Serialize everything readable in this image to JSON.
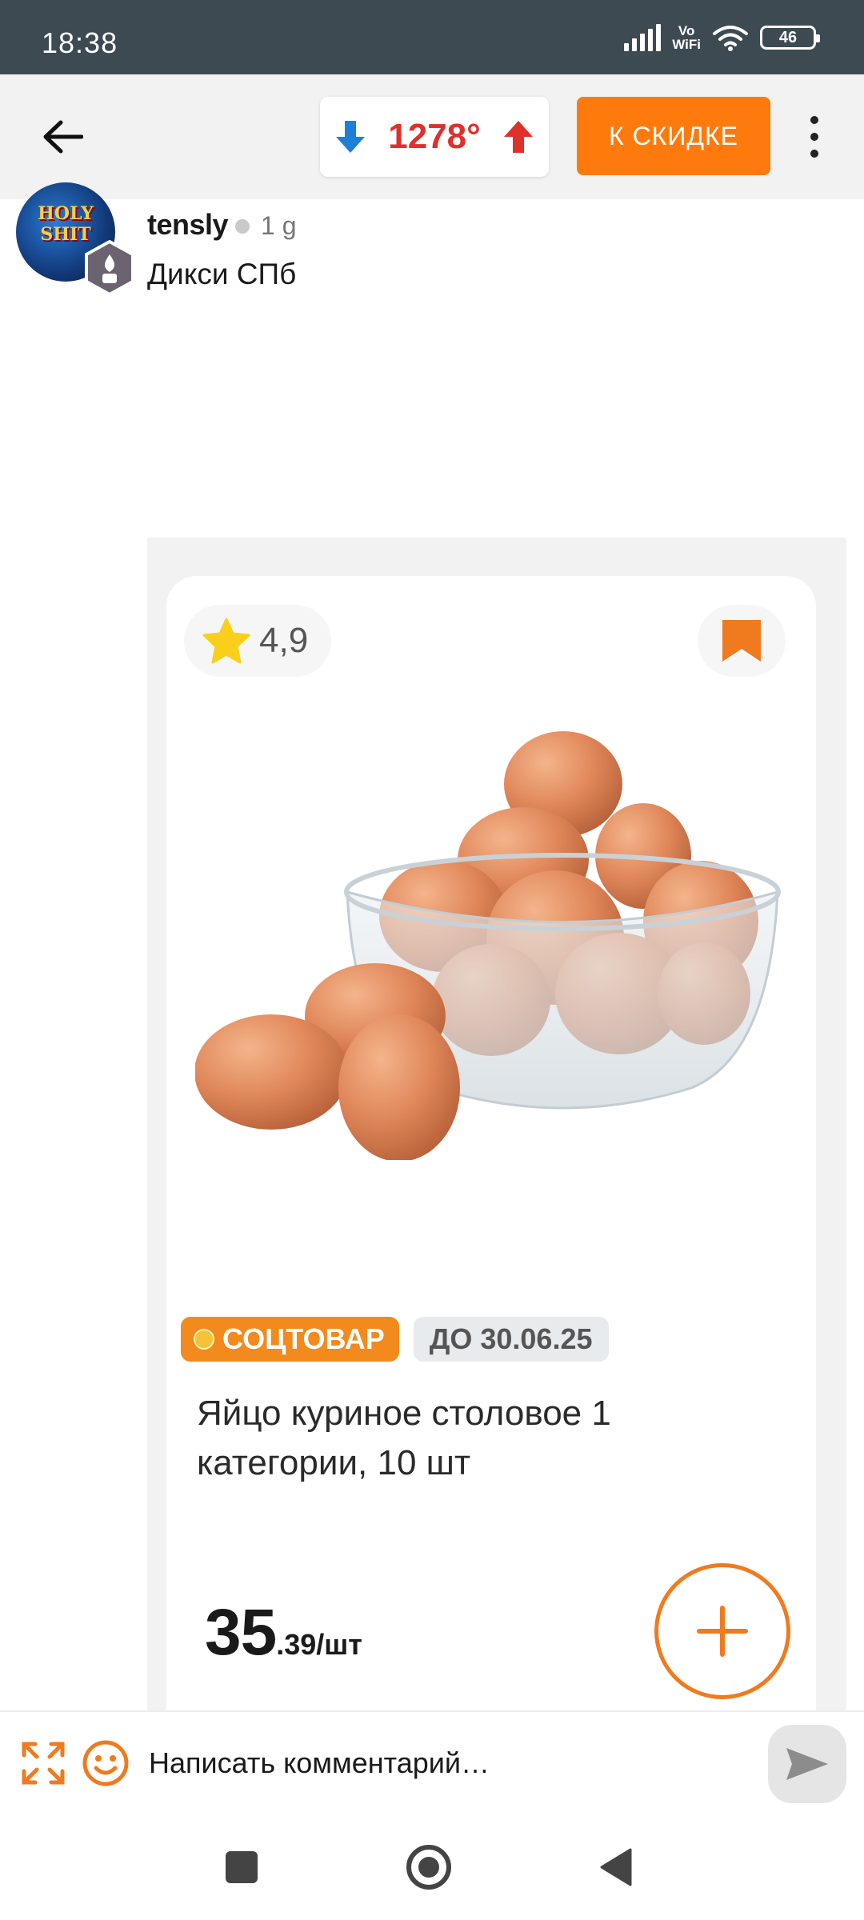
{
  "status_bar": {
    "time": "18:38",
    "network_label": "Vo\nWiFi",
    "battery": "46"
  },
  "toolbar": {
    "temperature": "1278°",
    "deal_button": "К СКИДКЕ"
  },
  "comment": {
    "avatar_text": "HOLY SHIT",
    "author": "tensly",
    "time": "1 g",
    "text": "Дикси СПб"
  },
  "product": {
    "rating": "4,9",
    "badge_soc": "СОЦТОВАР",
    "badge_date": "ДО 30.06.25",
    "title": "Яйцо куриное столовое 1 категории, 10 шт",
    "price_int": "35",
    "price_frac": ".39/шт"
  },
  "input_bar": {
    "placeholder": "Написать комментарий…"
  },
  "colors": {
    "accent": "#ff7a0d",
    "status_bar": "#3d4a52",
    "temp_red": "#e0302a",
    "arrow_blue": "#1e7fd8"
  }
}
